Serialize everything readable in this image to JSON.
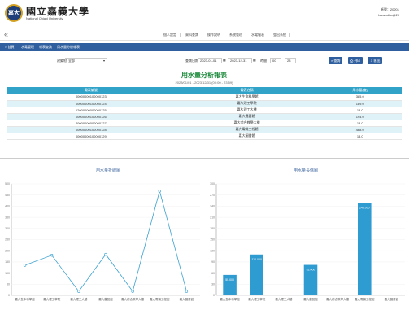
{
  "header": {
    "logo_zh": "國立嘉義大學",
    "logo_en": "National Chiayi University",
    "user_line1": "帳號：20201",
    "user_line2": "hanwnbtu@20",
    "logo_mark": "嘉大"
  },
  "nav": {
    "collapse": "«",
    "items": [
      "個人設定",
      "資料查詢",
      "操作說明",
      "系統管理",
      "水電報表",
      "登出系統"
    ]
  },
  "tabs": {
    "home": "首頁",
    "t1": "水電管理",
    "t2": "報表查詢",
    "t3": "用水量分析報表"
  },
  "filter": {
    "building_label": "建築物",
    "building_value": "全部",
    "date_label": "查詢日期",
    "date_from": "2023-01-01",
    "date_to": "2023-12-31",
    "time_label": "時間",
    "btn_search": "查詢",
    "btn_print": "列印",
    "btn_export": "匯出"
  },
  "report": {
    "title": "用水量分析報表",
    "subtitle": "2023/01/01 - 2023/12/31 (00:00 - 23:59)",
    "headers": [
      "電表編號",
      "電表名稱",
      "用水量(度)"
    ],
    "rows": [
      [
        "00000000100000123",
        "嘉大生命科學館",
        "385.0"
      ],
      [
        "00000000100000124",
        "嘉大理工學院",
        "189.0"
      ],
      [
        "12000000000000125",
        "嘉大理工大樓",
        "18.0"
      ],
      [
        "00000000100000126",
        "嘉大農藝館",
        "194.0"
      ],
      [
        "20000000000000127",
        "嘉大綜合教學大樓",
        "18.0"
      ],
      [
        "00000000100000128",
        "嘉大電機工程館",
        "468.0"
      ],
      [
        "00000000100000129",
        "嘉大圖書館",
        "18.0"
      ]
    ]
  },
  "chart_data": [
    {
      "type": "line",
      "title": "用水量折線圖",
      "categories": [
        "嘉大生命科學館",
        "嘉大理工學院",
        "嘉大理工大樓",
        "嘉大農藝館",
        "嘉大綜合教學大樓",
        "嘉大電機工程館",
        "嘉大圖書館"
      ],
      "values": [
        135,
        180,
        18,
        184,
        18,
        468,
        18
      ],
      "ylim": [
        0,
        500
      ],
      "yticks": [
        0,
        50,
        100,
        150,
        200,
        250,
        300,
        350,
        400,
        450,
        500
      ],
      "color": "#3aa0d0"
    },
    {
      "type": "bar",
      "title": "用水量長條圖",
      "categories": [
        "嘉大生命科學館",
        "嘉大理工學院",
        "嘉大理工大樓",
        "嘉大農藝館",
        "嘉大綜合教學大樓",
        "嘉大電機工程館",
        "嘉大圖書館"
      ],
      "values": [
        55,
        110,
        2,
        82,
        2,
        248,
        2
      ],
      "labels": [
        "55.000",
        "110.000",
        "",
        "82.000",
        "",
        "248.000",
        ""
      ],
      "ylim": [
        0,
        300
      ],
      "yticks": [
        0,
        30,
        60,
        90,
        120,
        150,
        180,
        210,
        240,
        270,
        300
      ],
      "color": "#2e9bd1"
    }
  ]
}
